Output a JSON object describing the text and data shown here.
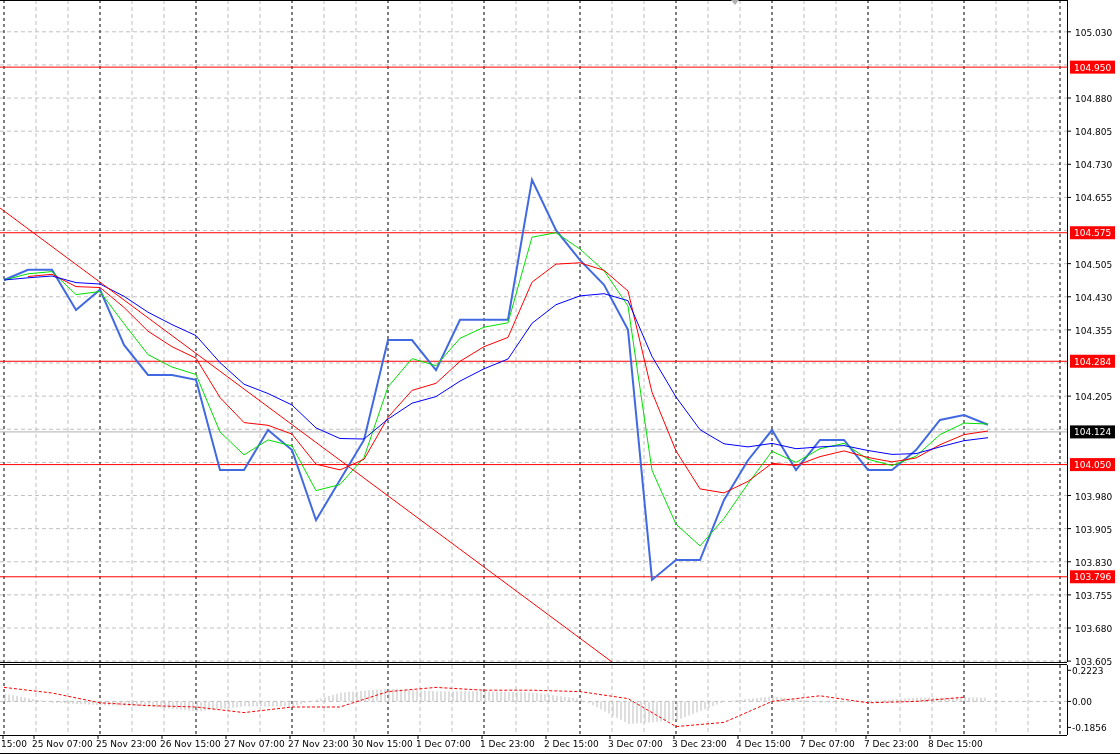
{
  "chart": {
    "chart_data": {
      "type": "line",
      "grid": true,
      "ylim": [
        103.603,
        105.102
      ],
      "yticks": [
        {
          "value": 105.03,
          "label": "105.030"
        },
        {
          "value": 104.88,
          "label": "104.880"
        },
        {
          "value": 104.805,
          "label": "104.805"
        },
        {
          "value": 104.73,
          "label": "104.730"
        },
        {
          "value": 104.655,
          "label": "104.655"
        },
        {
          "value": 104.505,
          "label": "104.505"
        },
        {
          "value": 104.43,
          "label": "104.430"
        },
        {
          "value": 104.355,
          "label": "104.355"
        },
        {
          "value": 104.205,
          "label": "104.205"
        },
        {
          "value": 103.98,
          "label": "103.980"
        },
        {
          "value": 103.905,
          "label": "103.905"
        },
        {
          "value": 103.83,
          "label": "103.830"
        },
        {
          "value": 103.755,
          "label": "103.755"
        },
        {
          "value": 103.68,
          "label": "103.680"
        },
        {
          "value": 103.605,
          "label": "103.605"
        }
      ],
      "series": [
        {
          "color": "#4169e1",
          "values": [
            104.468,
            104.491,
            104.491,
            104.4,
            104.446,
            104.321,
            104.253,
            104.253,
            104.242,
            104.038,
            104.038,
            104.128,
            104.083,
            103.924,
            104.015,
            104.106,
            104.332,
            104.332,
            104.264,
            104.378,
            104.378,
            104.378,
            104.695,
            104.581,
            104.513,
            104.457,
            104.355,
            103.789,
            103.834,
            103.834,
            103.97,
            104.06,
            104.128,
            104.038,
            104.106,
            104.106,
            104.038,
            104.038,
            104.083,
            104.151,
            104.162,
            104.14
          ]
        },
        {
          "color": "#00e000",
          "values": [
            104.468,
            104.482,
            104.487,
            104.435,
            104.442,
            104.369,
            104.299,
            104.271,
            104.254,
            104.124,
            104.072,
            104.106,
            104.092,
            103.991,
            104.005,
            104.066,
            104.226,
            104.29,
            104.274,
            104.336,
            104.361,
            104.371,
            104.565,
            104.575,
            104.538,
            104.489,
            104.409,
            104.037,
            103.915,
            103.866,
            103.928,
            104.007,
            104.08,
            104.055,
            104.086,
            104.098,
            104.062,
            104.048,
            104.069,
            104.118,
            104.144,
            104.142
          ]
        },
        {
          "color": "#ff0000",
          "values": [
            null,
            104.476,
            104.481,
            104.453,
            104.451,
            104.406,
            104.352,
            104.317,
            104.291,
            104.202,
            104.145,
            104.139,
            104.119,
            104.051,
            104.038,
            104.062,
            104.157,
            104.218,
            104.234,
            104.284,
            104.317,
            104.338,
            104.463,
            104.504,
            104.507,
            104.49,
            104.443,
            104.214,
            104.081,
            103.995,
            103.986,
            104.012,
            104.053,
            104.048,
            104.068,
            104.081,
            104.066,
            104.056,
            104.065,
            104.095,
            104.118,
            104.126
          ]
        },
        {
          "color": "#0000ff",
          "values": [
            104.468,
            104.473,
            104.477,
            104.462,
            104.459,
            104.431,
            104.395,
            104.367,
            104.342,
            104.281,
            104.232,
            104.211,
            104.185,
            104.133,
            104.109,
            104.108,
            104.153,
            104.189,
            104.204,
            104.239,
            104.267,
            104.289,
            104.37,
            104.412,
            104.432,
            104.437,
            104.421,
            104.295,
            104.203,
            104.129,
            104.097,
            104.09,
            104.098,
            104.086,
            104.09,
            104.093,
            104.082,
            104.073,
            104.075,
            104.09,
            104.104,
            104.111
          ]
        }
      ],
      "ref_lines": [
        {
          "axis": "y",
          "value": 104.95,
          "label": "104.950",
          "color": "#ff0000"
        },
        {
          "axis": "y",
          "value": 104.575,
          "label": "104.575",
          "color": "#ff0000"
        },
        {
          "axis": "y",
          "value": 104.284,
          "label": "104.284",
          "color": "#ff0000"
        },
        {
          "axis": "y",
          "value": 104.05,
          "label": "104.050",
          "color": "#ff0000"
        },
        {
          "axis": "y",
          "value": 103.796,
          "label": "103.796",
          "color": "#ff0000"
        },
        {
          "axis": "y",
          "value": 104.124,
          "label": "104.124",
          "color": "#b0b0b0"
        }
      ]
    },
    "trend_line": {
      "color": "#ff0000"
    },
    "time_labels": [
      "15:00",
      "25 Nov 07:00",
      "25 Nov 23:00",
      "26 Nov 15:00",
      "27 Nov 07:00",
      "27 Nov 23:00",
      "30 Nov 15:00",
      "1 Dec 07:00",
      "1 Dec 23:00",
      "2 Dec 15:00",
      "3 Dec 07:00",
      "3 Dec 23:00",
      "4 Dec 15:00",
      "7 Dec 07:00",
      "7 Dec 23:00",
      "8 Dec 15:00"
    ]
  },
  "indicator": {
    "chart_data": {
      "type": "line",
      "grid": true,
      "ylim": [
        -0.24,
        0.26
      ],
      "yticks": [
        {
          "value": 0.2223,
          "label": "0.2223"
        },
        {
          "value": 0,
          "label": "0.00"
        },
        {
          "value": -0.1856,
          "label": "-0.1856"
        }
      ],
      "series": [
        {
          "color": "#ff0000",
          "line_style": "dashed",
          "values": [
            0.1,
            0.06,
            -0.01,
            -0.03,
            -0.04,
            -0.08,
            -0.04,
            -0.04,
            0.07,
            0.1,
            0.08,
            0.08,
            0.07,
            0.02,
            -0.18,
            -0.15,
            0.0,
            0.04,
            -0.01,
            0.0,
            0.03
          ]
        }
      ]
    }
  }
}
